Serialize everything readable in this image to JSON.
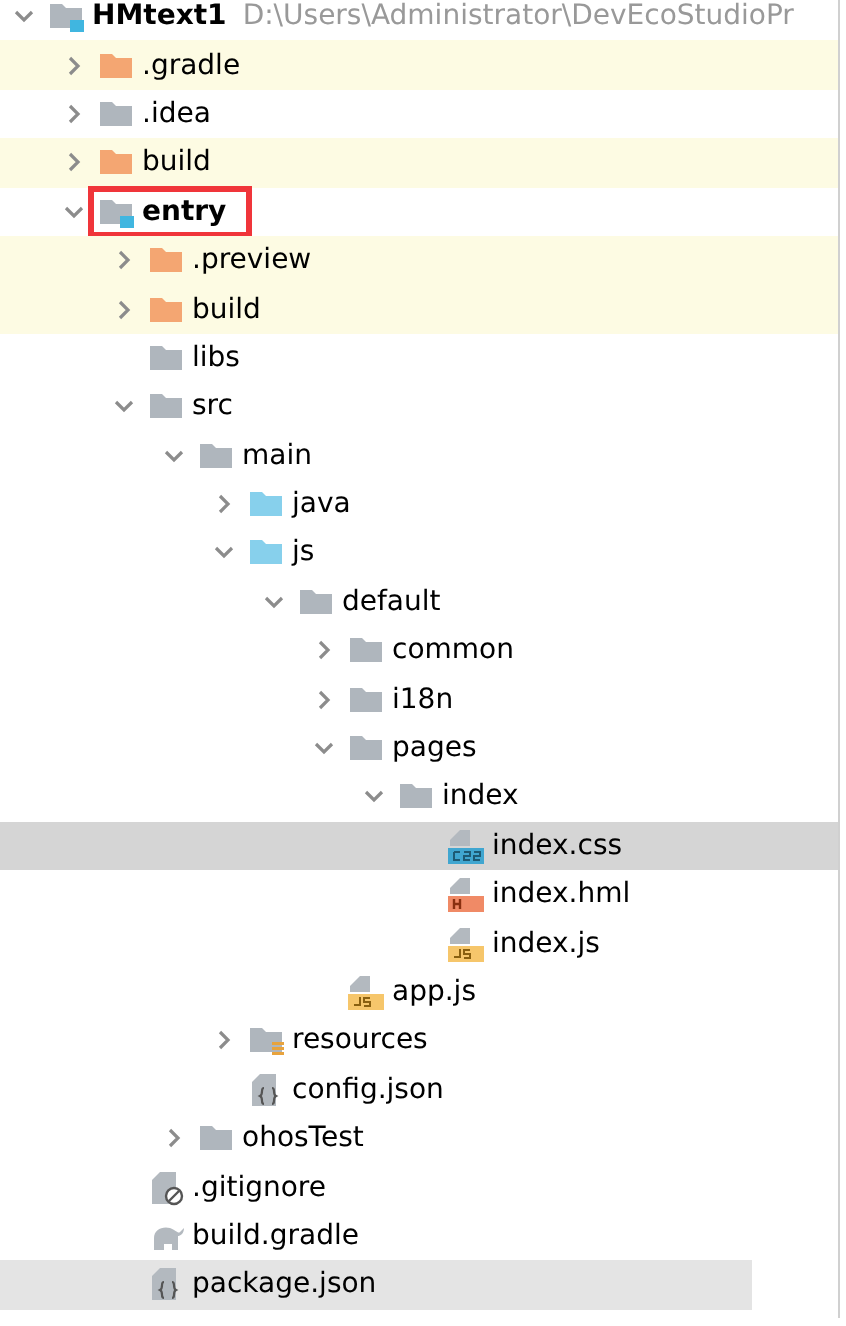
{
  "project_tree": {
    "root": {
      "name": "HMtext1",
      "path": "D:\\Users\\Administrator\\DevEcoStudioPr",
      "kind": "module",
      "expanded": true,
      "selected": false,
      "children": [
        {
          "name": ".gradle",
          "kind": "excluded-folder",
          "expanded": false,
          "selected": false
        },
        {
          "name": ".idea",
          "kind": "folder",
          "expanded": false,
          "selected": false
        },
        {
          "name": "build",
          "kind": "excluded-folder",
          "expanded": false,
          "selected": false
        },
        {
          "name": "entry",
          "kind": "module",
          "expanded": true,
          "selected": false,
          "annotated": true,
          "children": [
            {
              "name": ".preview",
              "kind": "excluded-folder",
              "expanded": false,
              "selected": false
            },
            {
              "name": "build",
              "kind": "excluded-folder",
              "expanded": false,
              "selected": false
            },
            {
              "name": "libs",
              "kind": "folder",
              "selected": false
            },
            {
              "name": "src",
              "kind": "folder",
              "expanded": true,
              "selected": false,
              "children": [
                {
                  "name": "main",
                  "kind": "folder",
                  "expanded": true,
                  "selected": false,
                  "children": [
                    {
                      "name": "java",
                      "kind": "source-folder",
                      "expanded": false,
                      "selected": false
                    },
                    {
                      "name": "js",
                      "kind": "source-folder",
                      "expanded": true,
                      "selected": false,
                      "children": [
                        {
                          "name": "default",
                          "kind": "folder",
                          "expanded": true,
                          "selected": false,
                          "children": [
                            {
                              "name": "common",
                              "kind": "folder",
                              "expanded": false,
                              "selected": false
                            },
                            {
                              "name": "i18n",
                              "kind": "folder",
                              "expanded": false,
                              "selected": false
                            },
                            {
                              "name": "pages",
                              "kind": "folder",
                              "expanded": true,
                              "selected": false,
                              "children": [
                                {
                                  "name": "index",
                                  "kind": "folder",
                                  "expanded": true,
                                  "selected": false,
                                  "children": [
                                    {
                                      "name": "index.css",
                                      "kind": "css-file",
                                      "selected": true
                                    },
                                    {
                                      "name": "index.hml",
                                      "kind": "hml-file",
                                      "selected": false
                                    },
                                    {
                                      "name": "index.js",
                                      "kind": "js-file",
                                      "selected": false
                                    }
                                  ]
                                }
                              ]
                            },
                            {
                              "name": "app.js",
                              "kind": "js-file",
                              "selected": false
                            }
                          ]
                        }
                      ]
                    },
                    {
                      "name": "resources",
                      "kind": "resource-folder",
                      "expanded": false,
                      "selected": false
                    },
                    {
                      "name": "config.json",
                      "kind": "json-file",
                      "selected": false
                    }
                  ]
                },
                {
                  "name": "ohosTest",
                  "kind": "folder",
                  "expanded": false,
                  "selected": false
                }
              ]
            },
            {
              "name": ".gitignore",
              "kind": "ignore-file",
              "selected": false
            },
            {
              "name": "build.gradle",
              "kind": "gradle-file",
              "selected": false
            },
            {
              "name": "package.json",
              "kind": "json-file",
              "selected": false,
              "hovered": true
            }
          ]
        }
      ]
    }
  }
}
